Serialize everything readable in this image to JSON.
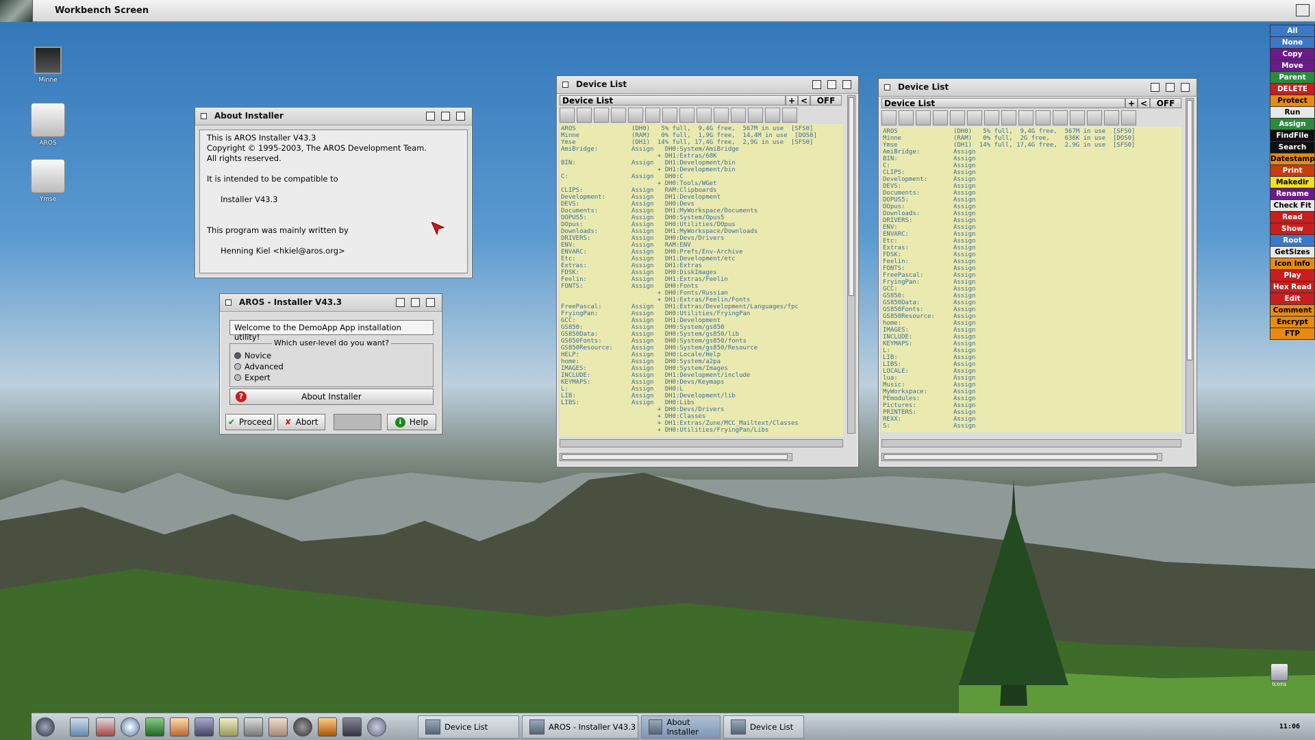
{
  "screen": {
    "title": "Workbench Screen"
  },
  "desktop_icons": [
    {
      "label": "Minne"
    },
    {
      "label": "AROS"
    },
    {
      "label": "Ymse"
    }
  ],
  "about_window": {
    "title": "About Installer",
    "lines": [
      "This is AROS Installer V43.3",
      "Copyright © 1995-2003, The AROS Development Team.",
      "All rights reserved.",
      "",
      "It is intended to be compatible to",
      "",
      "Installer V43.3",
      "",
      "",
      "This program was mainly written by",
      "",
      "Henning Kiel <hkiel@aros.org>"
    ]
  },
  "installer": {
    "title": "AROS - Installer V43.3",
    "welcome": "Welcome to the DemoApp App installation utility!",
    "group_label": "Which user-level do you want?",
    "options": [
      "Novice",
      "Advanced",
      "Expert"
    ],
    "selected": "Novice",
    "about_button": "About Installer",
    "proceed": "Proceed",
    "abort": "Abort",
    "help": "Help"
  },
  "dev1": {
    "title": "Device List",
    "header": "Device List",
    "plus": "+",
    "lt": "<",
    "off": "OFF",
    "text": "AROS               (DH0)   5% full,  9,4G free,  567M in use  [SFS0]\nMinne              (RAM)   0% full,  1,9G free,  14,4M in use  [DOS0]\nYmse               (DH1)  14% full, 17,4G free,  2,9G in use  [SFS0]\nAmiBridge:         Assign   DH0:System/AmiBridge\n                          + DH1:Extras/68K\nBIN:               Assign   DH1:Development/bin\n                          + DH1:Development/bin\nC:                 Assign   DH0:C\n                          + DH0:Tools/WGet\nCLIPS:             Assign   RAM:Clipboards\nDevelopment:       Assign   DH1:Development\nDEVS:              Assign   DH0:Devs\nDocuments:         Assign   DH1:MyWorkspace/Documents\nDOPUS5:            Assign   DH0:System/Opus5\nDOpus:             Assign   DH0:Utilities/DOpus\nDownloads:         Assign   DH1:MyWorkspace/Downloads\nDRIVERS:           Assign   DH0:Devs/Drivers\nENV:               Assign   RAM:ENV\nENVARC:            Assign   DH0:Prefs/Env-Archive\nEtc:               Assign   DH1:Development/etc\nExtras:            Assign   DH1:Extras\nFDSK:              Assign   DH0:DiskImages\nFeelin:            Assign   DH1:Extras/Feelin\nFONTS:             Assign   DH0:Fonts\n                          + DH0:Fonts/Russian\n                          + DH1:Extras/Feelin/Fonts\nFreePascal:        Assign   DH1:Extras/Development/Languages/fpc\nFryingPan:         Assign   DH0:Utilities/FryingPan\nGCC:               Assign   DH1:Development\nGS850:             Assign   DH0:System/gs850\nGS850Data:         Assign   DH0:System/gs850/lib\nGS850Fonts:        Assign   DH0:System/gs850/fonts\nGS850Resource:     Assign   DH0:System/gs850/Resource\nHELP:              Assign   DH0:Locale/Help\nhome:              Assign   DH0:System/a2pa\nIMAGES:            Assign   DH0:System/Images\nINCLUDE:           Assign   DH1:Development/include\nKEYMAPS:           Assign   DH0:Devs/Keymaps\nL:                 Assign   DH0:L\nLIB:               Assign   DH1:Development/lib\nLIBS:              Assign   DH0:Libs\n                          + DH0:Devs/Drivers\n                          + DH0:Classes\n                          + DH1:Extras/Zune/MCC_Mailtext/Classes\n                          + DH0:Utilities/FryingPan/Libs"
  },
  "dev2": {
    "title": "Device List",
    "header": "Device List",
    "plus": "+",
    "lt": "<",
    "off": "OFF",
    "text": "AROS               (DH0)   5% full,  9,4G free,  567M in use  [SFS0]\nMinne              (RAM)   0% full,  2G free,    636K in use  [DOS0]\nYmse               (DH1)  14% full, 17,4G free,  2,9G in use  [SFS0]\nAmiBridge:         Assign\nBIN:               Assign\nC:                 Assign\nCLIPS:             Assign\nDevelopment:       Assign\nDEVS:              Assign\nDocuments:         Assign\nDOPUS5:            Assign\nDOpus:             Assign\nDownloads:         Assign\nDRIVERS:           Assign\nENV:               Assign\nENVARC:            Assign\nEtc:               Assign\nExtras:            Assign\nFDSK:              Assign\nFeelin:            Assign\nFONTS:             Assign\nFreePascal:        Assign\nFryingPan:         Assign\nGCC:               Assign\nGS850:             Assign\nGS850Data:         Assign\nGS850Fonts:        Assign\nGS850Resource:     Assign\nhome:              Assign\nIMAGES:            Assign\nINCLUDE:           Assign\nKEYMAPS:           Assign\nL:                 Assign\nLIB:               Assign\nLIBS:              Assign\nLOCALE:            Assign\nlua:               Assign\nMusic:             Assign\nMyWorkspace:       Assign\nPEmodules:         Assign\nPictures:          Assign\nPRINTERS:          Assign\nREXX:              Assign\nS:                 Assign"
  },
  "button_bank": [
    {
      "label": "All",
      "bg": "#3c78c8",
      "fg": "#ffffff"
    },
    {
      "label": "None",
      "bg": "#3c78c8",
      "fg": "#ffffff"
    },
    {
      "label": "Copy",
      "bg": "#6a1a8a",
      "fg": "#ffffff"
    },
    {
      "label": "Move",
      "bg": "#6a1a8a",
      "fg": "#ffffff"
    },
    {
      "label": "Parent",
      "bg": "#2c8a3c",
      "fg": "#ffffff"
    },
    {
      "label": "DELETE",
      "bg": "#c81e1e",
      "fg": "#ffffff"
    },
    {
      "label": "Protect",
      "bg": "#e88a10",
      "fg": "#000000"
    },
    {
      "label": "Run",
      "bg": "#e8e8e8",
      "fg": "#000000"
    },
    {
      "label": "Assign",
      "bg": "#2c8a3c",
      "fg": "#ffffff"
    },
    {
      "label": "FindFile",
      "bg": "#101010",
      "fg": "#ffffff"
    },
    {
      "label": "Search",
      "bg": "#101010",
      "fg": "#ffffff"
    },
    {
      "label": "Datestamp",
      "bg": "#e88a10",
      "fg": "#000000"
    },
    {
      "label": "Print",
      "bg": "#c83c10",
      "fg": "#ffffff"
    },
    {
      "label": "Makedir",
      "bg": "#f0e020",
      "fg": "#000000"
    },
    {
      "label": "Rename",
      "bg": "#6a1a8a",
      "fg": "#ffffff"
    },
    {
      "label": "Check Fit",
      "bg": "#e8e8e8",
      "fg": "#000000"
    },
    {
      "label": "Read",
      "bg": "#c81e1e",
      "fg": "#ffffff"
    },
    {
      "label": "Show",
      "bg": "#c81e1e",
      "fg": "#ffffff"
    },
    {
      "label": "Root",
      "bg": "#3c78c8",
      "fg": "#ffffff"
    },
    {
      "label": "GetSizes",
      "bg": "#e8e8e8",
      "fg": "#000000"
    },
    {
      "label": "Icon Info",
      "bg": "#e88a10",
      "fg": "#000000"
    },
    {
      "label": "Play",
      "bg": "#c81e1e",
      "fg": "#ffffff"
    },
    {
      "label": "Hex Read",
      "bg": "#c81e1e",
      "fg": "#ffffff"
    },
    {
      "label": "Edit",
      "bg": "#c81e1e",
      "fg": "#ffffff"
    },
    {
      "label": "Comment",
      "bg": "#e88a10",
      "fg": "#000000"
    },
    {
      "label": "Encrypt",
      "bg": "#e88a10",
      "fg": "#000000"
    },
    {
      "label": "FTP",
      "bg": "#e88a10",
      "fg": "#000000"
    }
  ],
  "dock": {
    "tasks": [
      {
        "label": "Device List"
      },
      {
        "label": "AROS - Installer V43.3"
      },
      {
        "label": "About Installer"
      },
      {
        "label": "Device List"
      }
    ],
    "clock": "11:06",
    "icons_label": "Icons"
  }
}
